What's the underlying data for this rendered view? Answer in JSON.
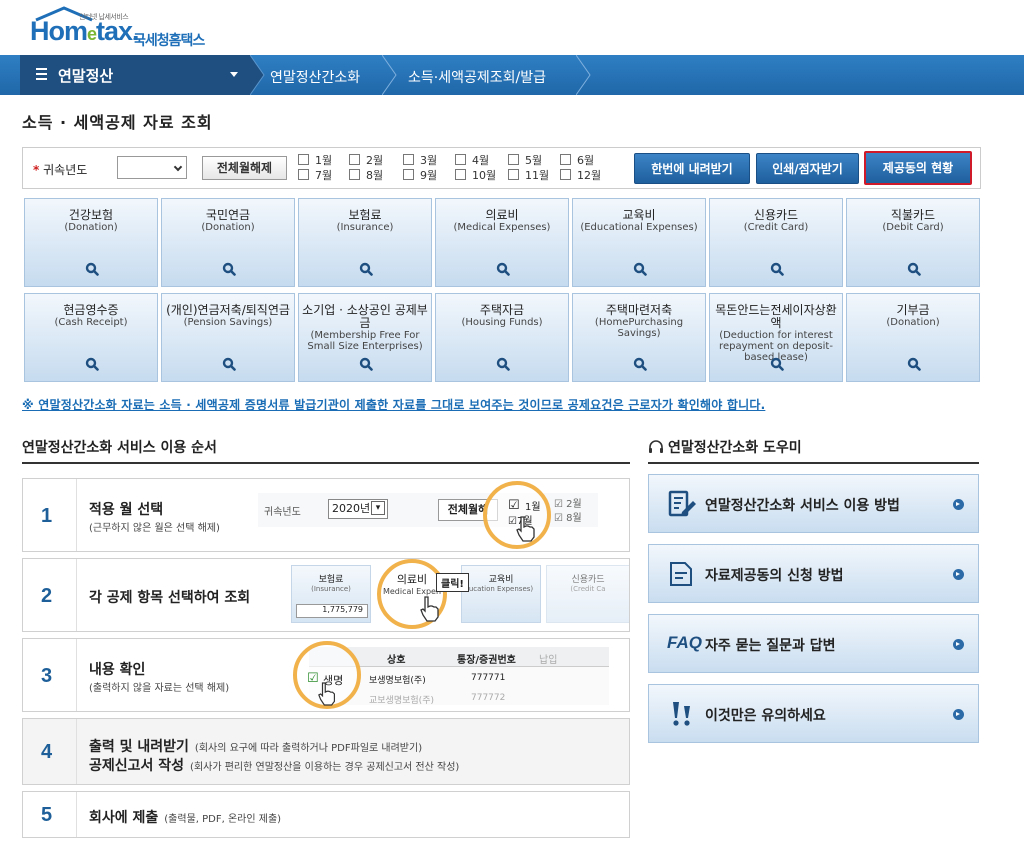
{
  "logo": {
    "brand": "Hom",
    "brand_e": "e",
    "brand_tail": "tax.",
    "tagline": "인터넷 납세서비스",
    "kor_name": "국세청홈택스"
  },
  "nav": {
    "main_label": "연말정산",
    "crumbs": [
      "연말정산간소화",
      "소득·세액공제조회/발급"
    ]
  },
  "page_title": "소득 · 세액공제 자료 조회",
  "filter": {
    "year_label": "귀속년도",
    "year_value": "",
    "clear_all": "전체월해제",
    "months": [
      "1월",
      "2월",
      "3월",
      "4월",
      "5월",
      "6월",
      "7월",
      "8월",
      "9월",
      "10월",
      "11월",
      "12월"
    ],
    "btn_download": "한번에 내려받기",
    "btn_print": "인쇄/점자받기",
    "btn_status": "제공동의 현황"
  },
  "tiles": [
    {
      "ko": "건강보험",
      "en": "(Donation)"
    },
    {
      "ko": "국민연금",
      "en": "(Donation)"
    },
    {
      "ko": "보험료",
      "en": "(Insurance)"
    },
    {
      "ko": "의료비",
      "en": "(Medical Expenses)"
    },
    {
      "ko": "교육비",
      "en": "(Educational Expenses)"
    },
    {
      "ko": "신용카드",
      "en": "(Credit Card)"
    },
    {
      "ko": "직불카드",
      "en": "(Debit Card)"
    },
    {
      "ko": "현금영수증",
      "en": "(Cash Receipt)"
    },
    {
      "ko": "(개인)연금저축/퇴직연금",
      "en": "(Pension Savings)"
    },
    {
      "ko": "소기업 · 소상공인 공제부금",
      "en": "(Membership Free For Small Size Enterprises)"
    },
    {
      "ko": "주택자금",
      "en": "(Housing Funds)"
    },
    {
      "ko": "주택마련저축",
      "en": "(HomePurchasing Savings)"
    },
    {
      "ko": "목돈안드는전세이자상환액",
      "en": "(Deduction for interest repayment on deposit-based lease)"
    },
    {
      "ko": "기부금",
      "en": "(Donation)"
    }
  ],
  "notice": "※ 연말정산간소화 자료는 소득 · 세액공제 증명서류 발급기관이 제출한 자료를 그대로 보여주는 것이므로 공제요건은 근로자가 확인해야 합니다.",
  "steps_title": "연말정산간소화 서비스 이용 순서",
  "steps": [
    {
      "num": "1",
      "title": "적용 월 선택",
      "sub": "(근무하지 않은 월은 선택 해제)"
    },
    {
      "num": "2",
      "title": "각 공제 항목 선택하여 조회",
      "sub": ""
    },
    {
      "num": "3",
      "title": "내용 확인",
      "sub": "(출력하지 않을 자료는 선택 해제)"
    },
    {
      "num": "4",
      "title": "출력 및 내려받기",
      "sub": "(회사의 요구에 따라 출력하거나 PDF파일로 내려받기)",
      "title2": "공제신고서 작성",
      "sub2": "(회사가 편리한 연말정산을 이용하는 경우 공제신고서 전산 작성)"
    },
    {
      "num": "5",
      "title": "회사에 제출",
      "sub": "(출력물, PDF, 온라인 제출)"
    }
  ],
  "illus": {
    "s1": {
      "year_label": "귀속년도",
      "year": "2020년",
      "clear": "전체월해",
      "m1": "1월",
      "m2": "2월",
      "m7": "7월",
      "m8": "8월"
    },
    "s2": {
      "t_ins": "보험료",
      "t_ins_en": "(Insurance)",
      "amount": "1,775,779",
      "t_med": "의료비",
      "t_med_en": "Medical Expen",
      "click": "클릭!",
      "t_edu": "교육비",
      "t_edu_en": "ucation Expenses)",
      "t_card": "신용카드",
      "t_card_en": "(Credit Ca"
    },
    "s3": {
      "col1": "상호",
      "col2": "통장/증권번호",
      "col3": "납입",
      "row1_name": "생명",
      "row1_co": "보생명보험(주)",
      "row1_no": "777771",
      "row2_co": "교보생명보험(주)",
      "row2_no": "777772"
    }
  },
  "help_title": "연말정산간소화 도우미",
  "help": [
    {
      "icon": "edit-doc-icon",
      "label": "연말정산간소화 서비스 이용 방법"
    },
    {
      "icon": "document-icon",
      "label": "자료제공동의 신청 방법"
    },
    {
      "icon": "faq-icon",
      "prefix": "FAQ",
      "label": "자주 묻는 질문과 답변"
    },
    {
      "icon": "exclamation-icon",
      "label": "이것만은 유의하세요"
    }
  ],
  "colors": {
    "primary": "#1f67a8",
    "dark": "#1e4f80",
    "tile_top": "#f2f7fc",
    "tile_bottom": "#c6dbef",
    "highlight": "#d01a2a",
    "ring": "#f1b24b"
  }
}
